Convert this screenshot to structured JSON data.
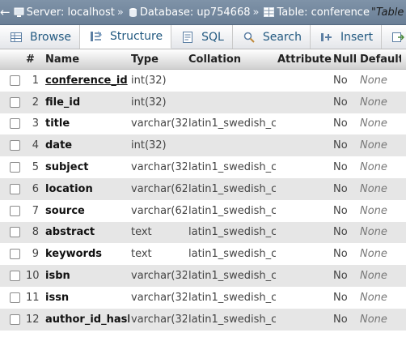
{
  "breadcrumb": {
    "back": "←",
    "server": "Server: localhost",
    "sep1": "»",
    "database": "Database: up754668",
    "sep2": "»",
    "table": "Table: conference",
    "comment": "\"Table for Co"
  },
  "tabs": [
    {
      "label": "Browse",
      "icon": "browse-icon"
    },
    {
      "label": "Structure",
      "icon": "structure-icon",
      "active": true
    },
    {
      "label": "SQL",
      "icon": "sql-icon"
    },
    {
      "label": "Search",
      "icon": "search-icon"
    },
    {
      "label": "Insert",
      "icon": "insert-icon"
    },
    {
      "label": "E",
      "icon": "export-icon"
    }
  ],
  "columns": [
    "#",
    "Name",
    "Type",
    "Collation",
    "Attributes",
    "Null",
    "Default",
    ""
  ],
  "rows": [
    {
      "num": "1",
      "name": "conference_id",
      "type": "int(32)",
      "collation": "",
      "attributes": "",
      "null": "No",
      "default": "None"
    },
    {
      "num": "2",
      "name": "file_id",
      "type": "int(32)",
      "collation": "",
      "attributes": "",
      "null": "No",
      "default": "None"
    },
    {
      "num": "3",
      "name": "title",
      "type": "varchar(32)",
      "collation": "latin1_swedish_ci",
      "attributes": "",
      "null": "No",
      "default": "None"
    },
    {
      "num": "4",
      "name": "date",
      "type": "int(32)",
      "collation": "",
      "attributes": "",
      "null": "No",
      "default": "None"
    },
    {
      "num": "5",
      "name": "subject",
      "type": "varchar(32)",
      "collation": "latin1_swedish_ci",
      "attributes": "",
      "null": "No",
      "default": "None"
    },
    {
      "num": "6",
      "name": "location",
      "type": "varchar(62)",
      "collation": "latin1_swedish_ci",
      "attributes": "",
      "null": "No",
      "default": "None"
    },
    {
      "num": "7",
      "name": "source",
      "type": "varchar(62)",
      "collation": "latin1_swedish_ci",
      "attributes": "",
      "null": "No",
      "default": "None"
    },
    {
      "num": "8",
      "name": "abstract",
      "type": "text",
      "collation": "latin1_swedish_ci",
      "attributes": "",
      "null": "No",
      "default": "None"
    },
    {
      "num": "9",
      "name": "keywords",
      "type": "text",
      "collation": "latin1_swedish_ci",
      "attributes": "",
      "null": "No",
      "default": "None"
    },
    {
      "num": "10",
      "name": "isbn",
      "type": "varchar(32)",
      "collation": "latin1_swedish_ci",
      "attributes": "",
      "null": "No",
      "default": "None"
    },
    {
      "num": "11",
      "name": "issn",
      "type": "varchar(32)",
      "collation": "latin1_swedish_ci",
      "attributes": "",
      "null": "No",
      "default": "None"
    },
    {
      "num": "12",
      "name": "author_id_hash",
      "type": "varchar(32)",
      "collation": "latin1_swedish_ci",
      "attributes": "",
      "null": "No",
      "default": "None"
    }
  ]
}
